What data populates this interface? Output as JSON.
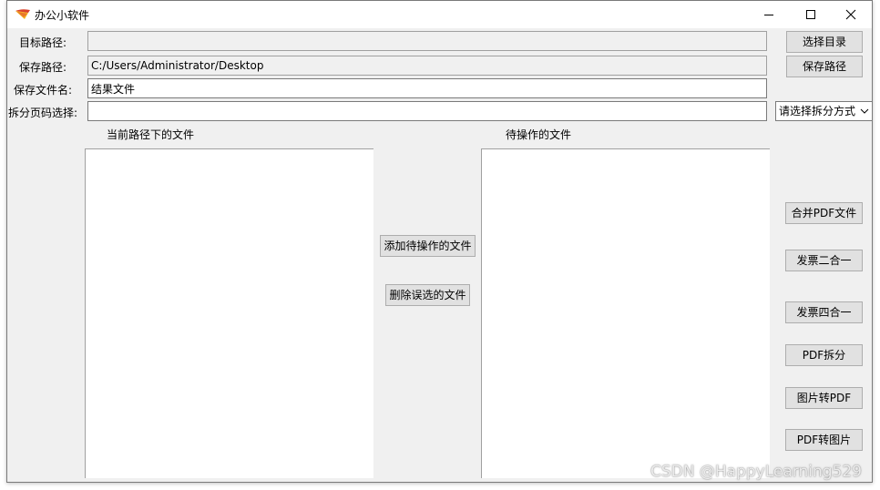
{
  "window": {
    "title": "办公小软件",
    "minimize_glyph": "─",
    "maximize_glyph": "☐",
    "close_glyph": "✕"
  },
  "form": {
    "target_path_label": "目标路径:",
    "target_path_value": "",
    "save_path_label": "保存路径:",
    "save_path_value": "C:/Users/Administrator/Desktop",
    "save_filename_label": "保存文件名:",
    "save_filename_value": "结果文件",
    "split_pages_label": "拆分页码选择:",
    "split_pages_value": "",
    "split_mode_selected": "请选择拆分方式"
  },
  "buttons": {
    "select_dir": "选择目录",
    "save_path": "保存路径",
    "add_files": "添加待操作的文件",
    "remove_files": "删除误选的文件",
    "merge_pdf": "合并PDF文件",
    "invoice_two_in_one": "发票二合一",
    "invoice_four_in_one": "发票四合一",
    "pdf_split": "PDF拆分",
    "image_to_pdf": "图片转PDF",
    "pdf_to_image": "PDF转图片"
  },
  "lists": {
    "current_files_header": "当前路径下的文件",
    "pending_files_header": "待操作的文件",
    "current_files": [],
    "pending_files": []
  },
  "watermark": "CSDN @HappyLearning529",
  "colors": {
    "window_bg": "#f0f0f0",
    "button_bg": "#e1e1e1",
    "icon_yellow": "#f5b21b",
    "icon_red": "#d9412b"
  }
}
